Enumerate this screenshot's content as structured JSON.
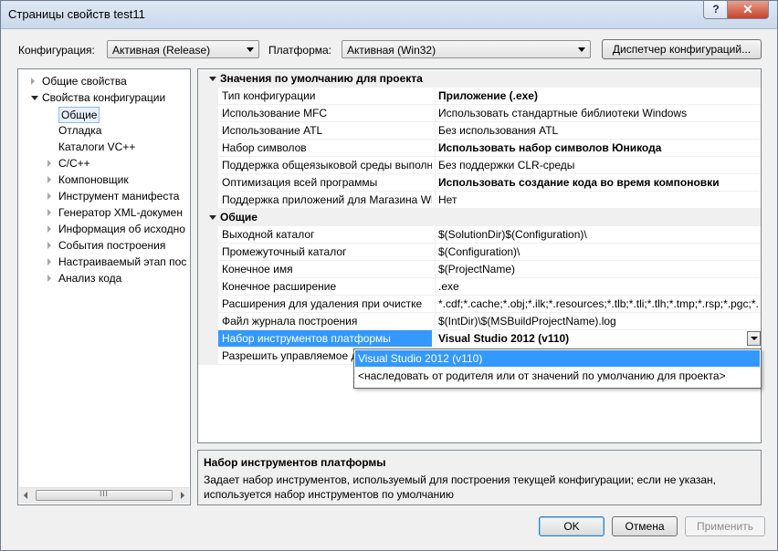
{
  "window": {
    "title": "Страницы свойств test11",
    "help_label": "?",
    "close_label": "✕"
  },
  "toolbar": {
    "config_label": "Конфигурация:",
    "config_value": "Активная (Release)",
    "platform_label": "Платформа:",
    "platform_value": "Активная (Win32)",
    "manager_button": "Диспетчер конфигураций..."
  },
  "tree": {
    "items": [
      {
        "label": "Общие свойства",
        "state": "collapsed"
      },
      {
        "label": "Свойства конфигурации",
        "state": "expanded"
      },
      {
        "label": "Общие",
        "state": "selected"
      },
      {
        "label": "Отладка",
        "state": "leaf"
      },
      {
        "label": "Каталоги VC++",
        "state": "leaf"
      },
      {
        "label": "C/C++",
        "state": "collapsed"
      },
      {
        "label": "Компоновщик",
        "state": "collapsed"
      },
      {
        "label": "Инструмент манифеста",
        "state": "collapsed"
      },
      {
        "label": "Генератор XML-докумен",
        "state": "collapsed"
      },
      {
        "label": "Информация об исходно",
        "state": "collapsed"
      },
      {
        "label": "События построения",
        "state": "collapsed"
      },
      {
        "label": "Настраиваемый этап пос",
        "state": "collapsed"
      },
      {
        "label": "Анализ кода",
        "state": "collapsed"
      }
    ],
    "scroll_grip": "III"
  },
  "grid": {
    "sections": [
      {
        "title": "Значения по умолчанию для проекта",
        "rows": [
          {
            "name": "Тип конфигурации",
            "value": "Приложение (.exe)",
            "bold": true
          },
          {
            "name": "Использование MFC",
            "value": "Использовать стандартные библиотеки Windows",
            "bold": false
          },
          {
            "name": "Использование ATL",
            "value": "Без использования ATL",
            "bold": false
          },
          {
            "name": "Набор символов",
            "value": "Использовать набор символов Юникода",
            "bold": true
          },
          {
            "name": "Поддержка общеязыковой среды выполн",
            "value": "Без поддержки CLR-среды",
            "bold": false
          },
          {
            "name": "Оптимизация всей программы",
            "value": "Использовать создание кода во время компоновки",
            "bold": true
          },
          {
            "name": "Поддержка приложений для Магазина Wi",
            "value": "Нет",
            "bold": false
          }
        ]
      },
      {
        "title": "Общие",
        "rows": [
          {
            "name": "Выходной каталог",
            "value": "$(SolutionDir)$(Configuration)\\",
            "bold": false
          },
          {
            "name": "Промежуточный каталог",
            "value": "$(Configuration)\\",
            "bold": false
          },
          {
            "name": "Конечное имя",
            "value": "$(ProjectName)",
            "bold": false
          },
          {
            "name": "Конечное расширение",
            "value": ".exe",
            "bold": false
          },
          {
            "name": "Расширения для удаления при очистке",
            "value": "*.cdf;*.cache;*.obj;*.ilk;*.resources;*.tlb;*.tli;*.tlh;*.tmp;*.rsp;*.pgc;*.p",
            "bold": false
          },
          {
            "name": "Файл журнала построения",
            "value": "$(IntDir)\\$(MSBuildProjectName).log",
            "bold": false
          },
          {
            "name": "Набор инструментов платформы",
            "value": "Visual Studio 2012 (v110)",
            "bold": true,
            "selected": true
          },
          {
            "name": "Разрешить управляемое д",
            "value": "",
            "bold": false
          }
        ]
      }
    ]
  },
  "dropdown": {
    "options": [
      {
        "label": "Visual Studio 2012 (v110)",
        "selected": true
      },
      {
        "label": "<наследовать от родителя или от значений по умолчанию для проекта>",
        "selected": false
      }
    ]
  },
  "description": {
    "title": "Набор инструментов платформы",
    "text": "Задает набор инструментов, используемый для построения текущей конфигурации; если не указан, используется набор инструментов по умолчанию"
  },
  "buttons": {
    "ok": "OK",
    "cancel": "Отмена",
    "apply": "Применить"
  }
}
